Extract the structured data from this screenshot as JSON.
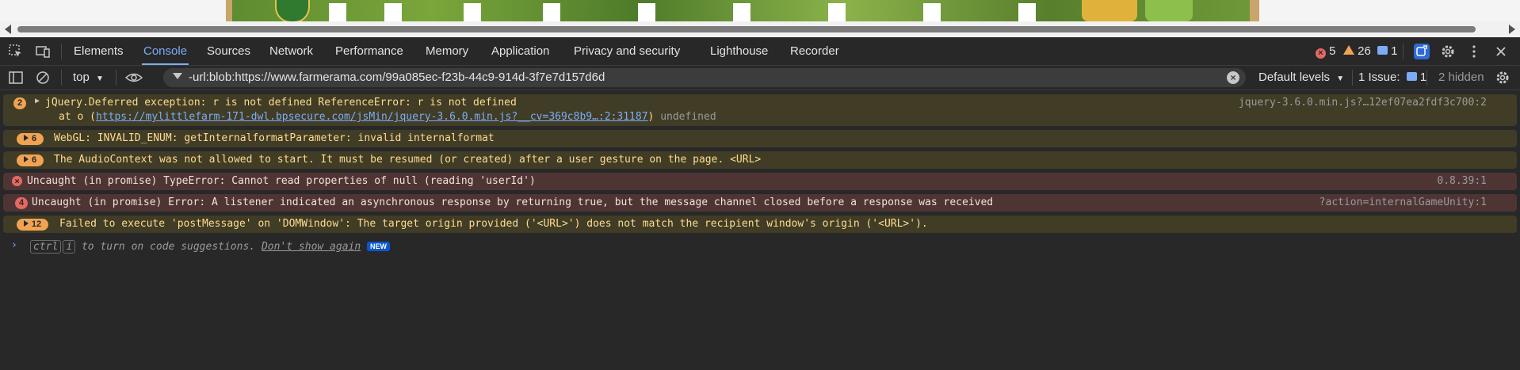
{
  "tabs": {
    "items": [
      "Elements",
      "Console",
      "Sources",
      "Network",
      "Performance",
      "Memory",
      "Application",
      "Privacy and security",
      "Lighthouse",
      "Recorder"
    ],
    "active": "Console"
  },
  "counts": {
    "errors": "5",
    "warnings": "26",
    "issues": "1"
  },
  "filterbar": {
    "context": "top",
    "filter_value": "-url:blob:https://www.farmerama.com/99a085ec-f23b-44c9-914d-3f7e7d157d6d",
    "levels": "Default levels",
    "issues_label": "1 Issue:",
    "issues_count": "1",
    "hidden": "2 hidden"
  },
  "messages": [
    {
      "level": "warning",
      "count": "2",
      "line1": "jQuery.Deferred exception: r is not defined ReferenceError: r is not defined",
      "line2_prefix": "at o (",
      "line2_link": "https://mylittlefarm-171-dwl.bpsecure.com/jsMin/jquery-3.6.0.min.js?__cv=369c8b9…:2:31187",
      "line2_suffix": ")",
      "line2_extra": "undefined",
      "source": "jquery-3.6.0.min.js?…12ef07ea2fdf3c700:2"
    },
    {
      "level": "warning",
      "count": "6",
      "text": "WebGL: INVALID_ENUM: getInternalformatParameter: invalid internalformat",
      "source": ""
    },
    {
      "level": "warning",
      "count": "6",
      "text": "The AudioContext was not allowed to start. It must be resumed (or created) after a user gesture on the page. <URL>",
      "source": ""
    },
    {
      "level": "error",
      "count": "",
      "text": "Uncaught (in promise) TypeError: Cannot read properties of null (reading 'userId')",
      "source": "0.8.39:1"
    },
    {
      "level": "error",
      "count": "4",
      "text": "Uncaught (in promise) Error: A listener indicated an asynchronous response by returning true, but the message channel closed before a response was received",
      "source": "?action=internalGameUnity:1"
    },
    {
      "level": "warning",
      "count": "12",
      "text": "Failed to execute 'postMessage' on 'DOMWindow': The target origin provided ('<URL>') does not match the recipient window's origin ('<URL>').",
      "source": ""
    }
  ],
  "prompt": {
    "key1": "ctrl",
    "key2": "i",
    "text": "to turn on code suggestions.",
    "dismiss": "Don't show again",
    "badge": "NEW"
  },
  "colors": {
    "accent": "#7cacf8",
    "warning": "#f0a353",
    "error": "#e46962",
    "bg": "#282828"
  }
}
